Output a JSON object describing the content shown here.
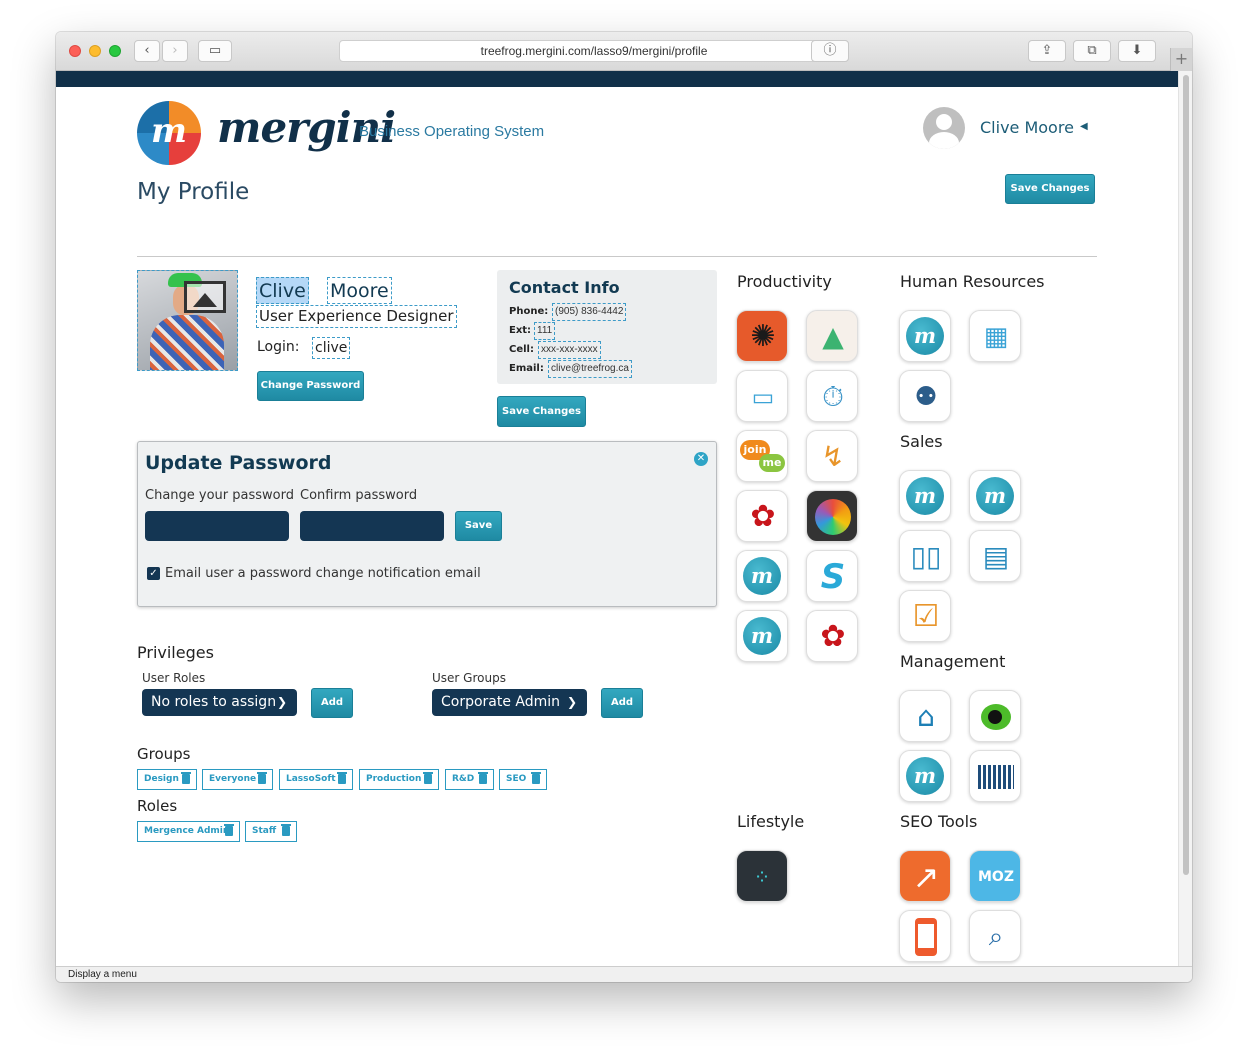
{
  "browser": {
    "url": "treefrog.mergini.com/lasso9/mergini/profile",
    "status_text": "Display a menu"
  },
  "header": {
    "logo_letter": "m",
    "logo_word": "mergini",
    "tagline": "Business Operating System",
    "user_name": "Clive Moore"
  },
  "page": {
    "title": "My Profile",
    "save_label": "Save Changes"
  },
  "profile": {
    "first_name": "Clive",
    "last_name": "Moore",
    "job_title": "User Experience Designer",
    "login_label": "Login:",
    "login": "clive",
    "change_password_label": "Change Password"
  },
  "contact": {
    "title": "Contact Info",
    "phone_label": "Phone:",
    "phone": "(905) 836-4442",
    "ext_label": "Ext:",
    "ext": "111",
    "cell_label": "Cell:",
    "cell": "xxx-xxx-xxxx",
    "email_label": "Email:",
    "email": "clive@treefrog.ca",
    "save_label": "Save Changes"
  },
  "password": {
    "title": "Update Password",
    "change_label": "Change your password",
    "confirm_label": "Confirm password",
    "save_label": "Save",
    "notify_label": "Email user a password change notification email",
    "notify_checked": true
  },
  "privileges": {
    "title": "Privileges",
    "roles_label": "User Roles",
    "roles_selected": "No roles to assign",
    "groups_label": "User Groups",
    "groups_selected": "Corporate Admin",
    "add_label": "Add"
  },
  "groups": {
    "title": "Groups",
    "items": [
      "Design",
      "Everyone",
      "LassoSoft",
      "Production",
      "R&D",
      "SEO"
    ]
  },
  "roles": {
    "title": "Roles",
    "items": [
      "Mergence Admin",
      "Staff"
    ]
  },
  "apps": {
    "productivity": "Productivity",
    "human_resources": "Human Resources",
    "sales": "Sales",
    "management": "Management",
    "lifestyle": "Lifestyle",
    "seo_tools": "SEO Tools",
    "join_text": "join",
    "me_text": "me",
    "moz_text": "MOZ"
  }
}
